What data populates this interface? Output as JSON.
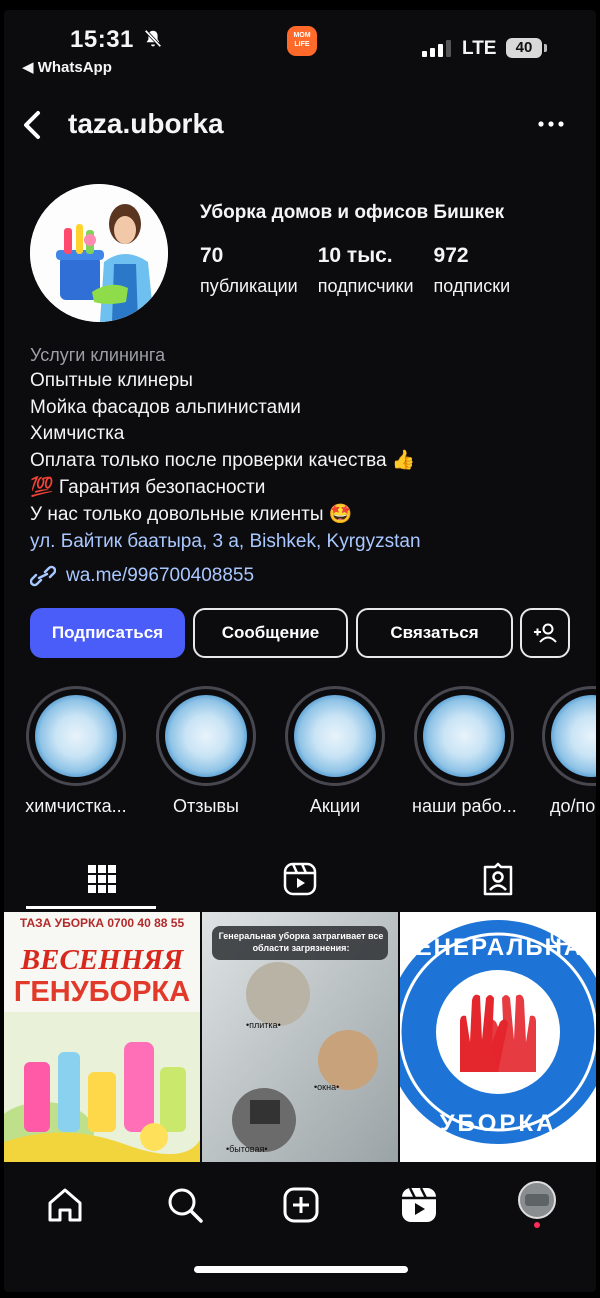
{
  "status_bar": {
    "time": "15:31",
    "back_app": "◀ WhatsApp",
    "network": "LTE",
    "battery": "40",
    "app_badge": "MOM LIFE"
  },
  "header": {
    "username": "taza.uborka"
  },
  "profile": {
    "display_name": "Уборка домов и офисов Бишкек",
    "stats": [
      {
        "value": "70",
        "label": "публикации"
      },
      {
        "value": "10 тыс.",
        "label": "подписчики"
      },
      {
        "value": "972",
        "label": "подписки"
      }
    ],
    "bio": {
      "category": "Услуги клининга",
      "lines": [
        "Опытные клинеры",
        "Мойка фасадов альпинистами",
        "Химчистка",
        "Оплата только после проверки качества 👍",
        "💯 Гарантия безопасности",
        "У нас только довольные клиенты 🤩"
      ],
      "address": "ул. Байтик баатыра, 3 а, Bishkek, Kyrgyzstan",
      "link": "wa.me/996700408855"
    }
  },
  "actions": {
    "follow": "Подписаться",
    "message": "Сообщение",
    "contact": "Связаться"
  },
  "highlights": [
    {
      "label": "химчистка..."
    },
    {
      "label": "Отзывы"
    },
    {
      "label": "Акции"
    },
    {
      "label": "наши рабо..."
    },
    {
      "label": "до/по"
    }
  ],
  "posts": [
    {
      "header": "ТАЗА УБОРКА 0700 40 88 55",
      "line1": "ВЕСЕННЯЯ",
      "line2": "ГЕНУБОРКА"
    },
    {
      "header": "Генеральная уборка затрагивает все области загрязнения:",
      "tag1": "•плитка•",
      "tag2": "•окна•",
      "tag3": "•бытовая•"
    },
    {
      "arc_top": "ГЕНЕРАЛЬНАЯ",
      "arc_bottom": "УБОРКА"
    }
  ],
  "colors": {
    "background": "#0c0c0f",
    "follow_button": "#4a5df9",
    "link": "#a9c8ff",
    "muted": "#9e9ea6"
  }
}
